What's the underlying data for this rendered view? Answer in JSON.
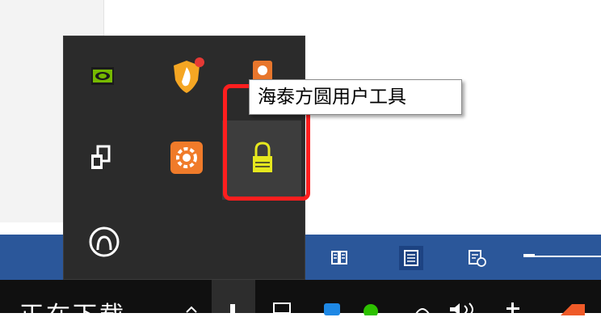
{
  "tray_overflow": {
    "icons": [
      {
        "name": "nvidia-icon",
        "color": "#76b900"
      },
      {
        "name": "shield-security-icon",
        "color": "#f5a623"
      },
      {
        "name": "orange-app-icon",
        "color": "#e8762c"
      },
      {
        "name": "devices-icon",
        "color": "#ffffff"
      },
      {
        "name": "orange-settings-app-icon",
        "color": "#f07b2a"
      },
      {
        "name": "lock-icon",
        "color": "#e6e81e"
      },
      {
        "name": "onedrive-sync-icon",
        "color": "#ffffff"
      }
    ],
    "tooltip": "海泰方圆用户工具",
    "highlight_color": "#ff1e1e"
  },
  "word_statusbar": {
    "background": "#2b579a",
    "views": [
      "read-mode-icon",
      "print-layout-icon",
      "web-layout-icon"
    ]
  },
  "taskbar": {
    "text": "正在下载",
    "background": "#101010"
  }
}
